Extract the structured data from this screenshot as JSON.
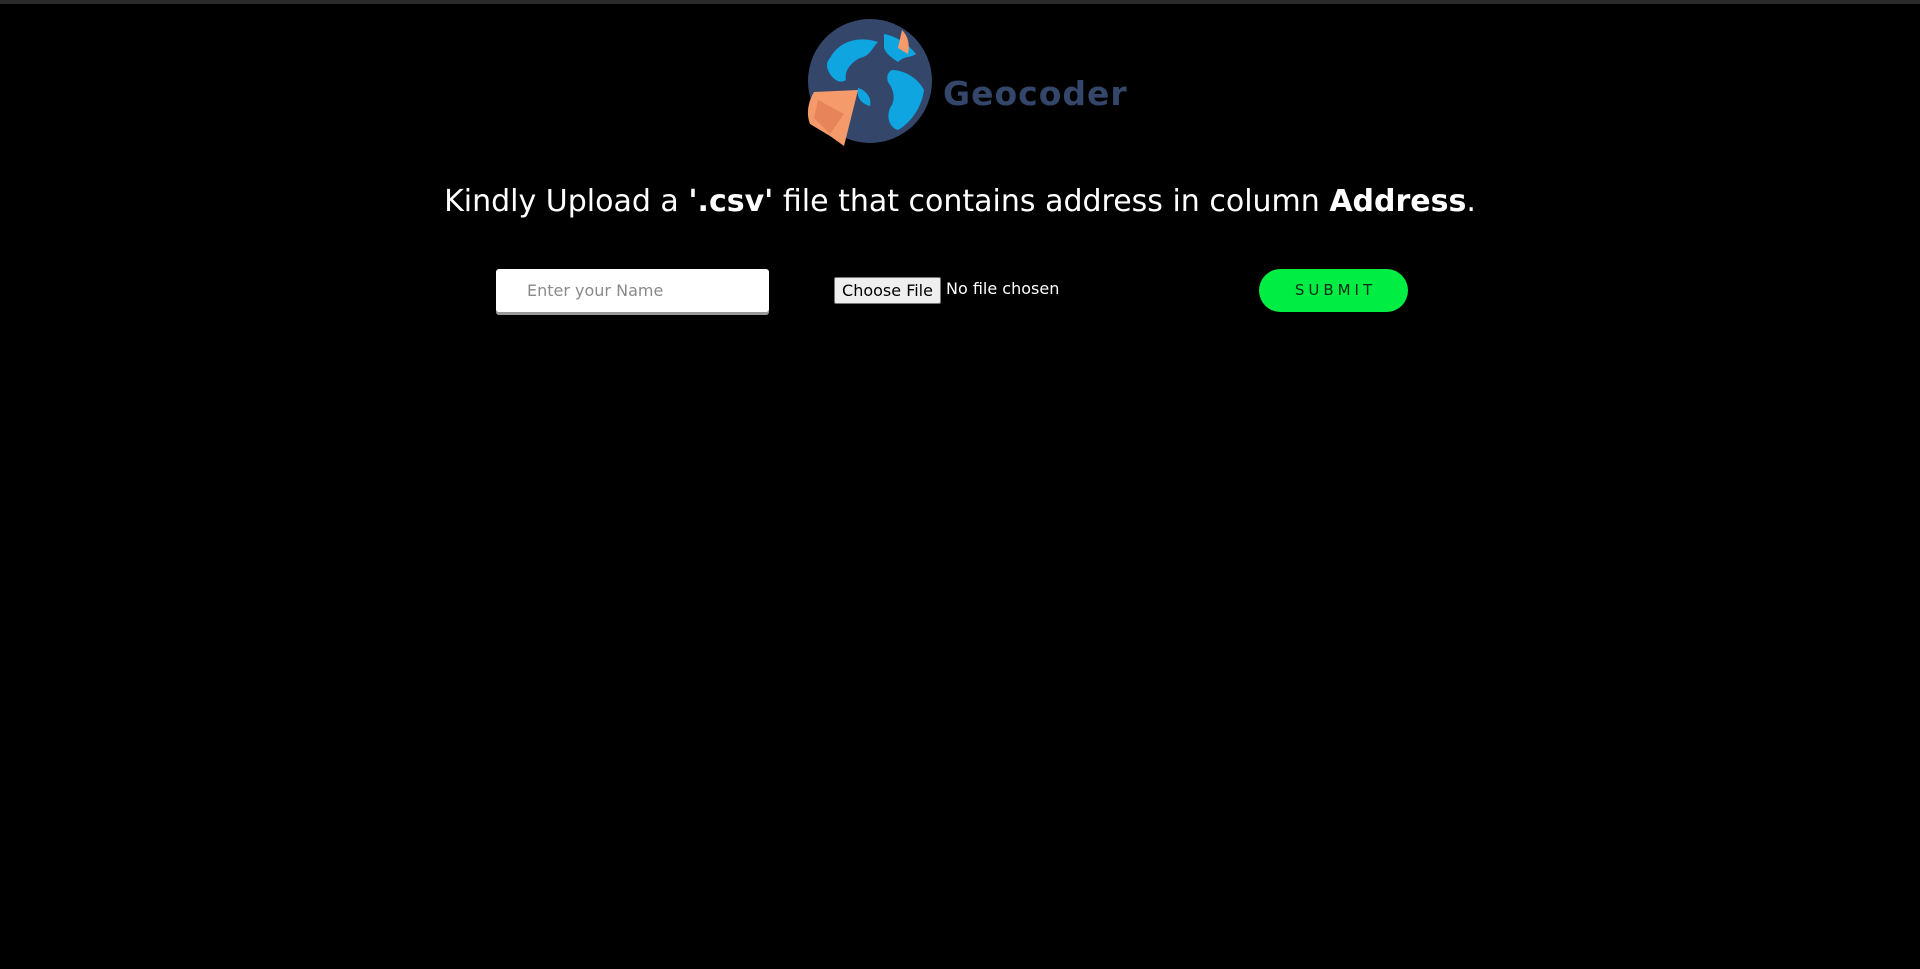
{
  "header": {
    "brand_name": "Geocoder",
    "logo_icon": "globe-with-marker-icon"
  },
  "headline": {
    "prefix": "Kindly Upload a ",
    "file_type": "'.csv'",
    "middle": " file that contains address in column ",
    "column_name": "Address",
    "suffix": "."
  },
  "form": {
    "name_placeholder": "Enter your Name",
    "name_value": "",
    "file_button_label": "Choose File",
    "file_status": "No file chosen",
    "submit_label": "SUBMIT"
  },
  "colors": {
    "background": "#000000",
    "brand_text": "#34476a",
    "globe_ocean": "#34476a",
    "globe_land": "#0ea5e0",
    "marker": "#f59a6a",
    "submit_bg": "#00ee44"
  }
}
